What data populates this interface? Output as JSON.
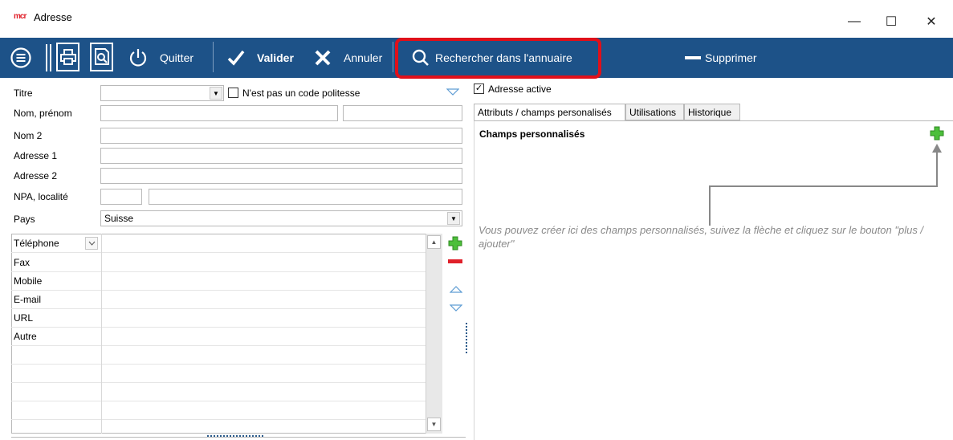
{
  "window": {
    "logo": "mcr",
    "title": "Adresse",
    "minimize": "—",
    "maximize": "☐",
    "close": "✕"
  },
  "toolbar": {
    "quit_label": "Quitter",
    "validate_label": "Valider",
    "cancel_label": "Annuler",
    "search_label": "Rechercher dans l'annuaire",
    "delete_label": "Supprimer",
    "bg_color": "#1d5288",
    "highlight_color": "#e0101a"
  },
  "form": {
    "titre_label": "Titre",
    "titre_value": "",
    "politesse_label": "N'est pas un code politesse",
    "nom_label": "Nom, prénom",
    "nom_value": "",
    "prenom_value": "",
    "nom2_label": "Nom 2",
    "nom2_value": "",
    "adresse1_label": "Adresse 1",
    "adresse1_value": "",
    "adresse2_label": "Adresse 2",
    "adresse2_value": "",
    "npa_label": "NPA, localité",
    "npa_value": "",
    "localite_value": "",
    "pays_label": "Pays",
    "pays_value": "Suisse"
  },
  "contacts": {
    "type_selected": "Téléphone",
    "rows": [
      "Fax",
      "Mobile",
      "E-mail",
      "URL",
      "Autre"
    ]
  },
  "right": {
    "adresse_active_label": "Adresse active",
    "tabs": [
      "Attributs / champs personalisés",
      "Utilisations",
      "Historique"
    ],
    "section_title": "Champs personnalisés",
    "hint": "Vous pouvez créer ici des champs personnalisés, suivez la flèche et cliquez sur le bouton \"plus / ajouter\""
  }
}
